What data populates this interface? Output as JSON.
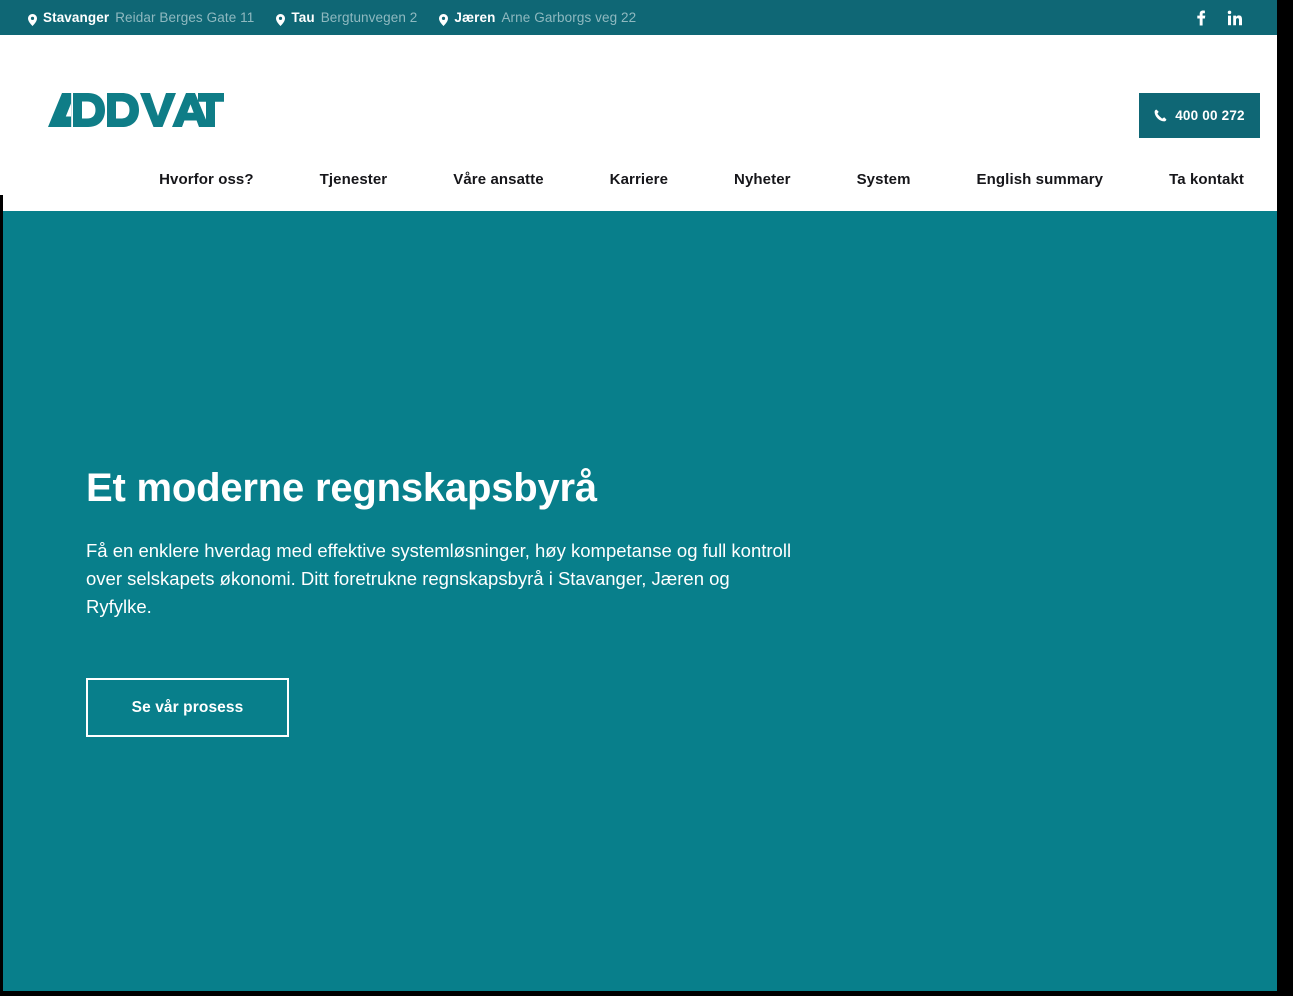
{
  "topbar": {
    "locations": [
      {
        "icon": "map-pin-icon",
        "city": "Stavanger",
        "address": "Reidar Berges Gate 11"
      },
      {
        "icon": "map-pin-icon",
        "city": "Tau",
        "address": "Bergtunvegen 2"
      },
      {
        "icon": "map-pin-icon",
        "city": "Jæren",
        "address": "Arne Garborgs veg 22"
      }
    ],
    "socials": [
      {
        "icon": "facebook-icon",
        "label": "Facebook"
      },
      {
        "icon": "linkedin-icon",
        "label": "LinkedIn"
      }
    ],
    "bg_color": "#0f6775",
    "city_color": "#ffffff",
    "address_color": "#8fb9c0"
  },
  "header": {
    "logo_text": "ADDVANT",
    "logo_color": "#0f7d87",
    "phone": {
      "icon": "phone-icon",
      "label": "400 00 272",
      "bg_color": "#0f6775"
    },
    "nav": [
      {
        "label": "Hvorfor oss?"
      },
      {
        "label": "Tjenester"
      },
      {
        "label": "Våre ansatte"
      },
      {
        "label": "Karriere"
      },
      {
        "label": "Nyheter"
      },
      {
        "label": "System"
      },
      {
        "label": "English summary"
      },
      {
        "label": "Ta kontakt"
      }
    ]
  },
  "hero": {
    "title": "Et moderne regnskapsbyrå",
    "subtitle": "Få en enklere hverdag med effektive systemløsninger, høy kompetanse og full kontroll over selskapets økonomi. Ditt foretrukne regnskapsbyrå i Stavanger, Jæren og Ryfylke.",
    "cta_label": "Se vår prosess",
    "bg_color": "#087f8b",
    "text_color": "#ffffff"
  }
}
